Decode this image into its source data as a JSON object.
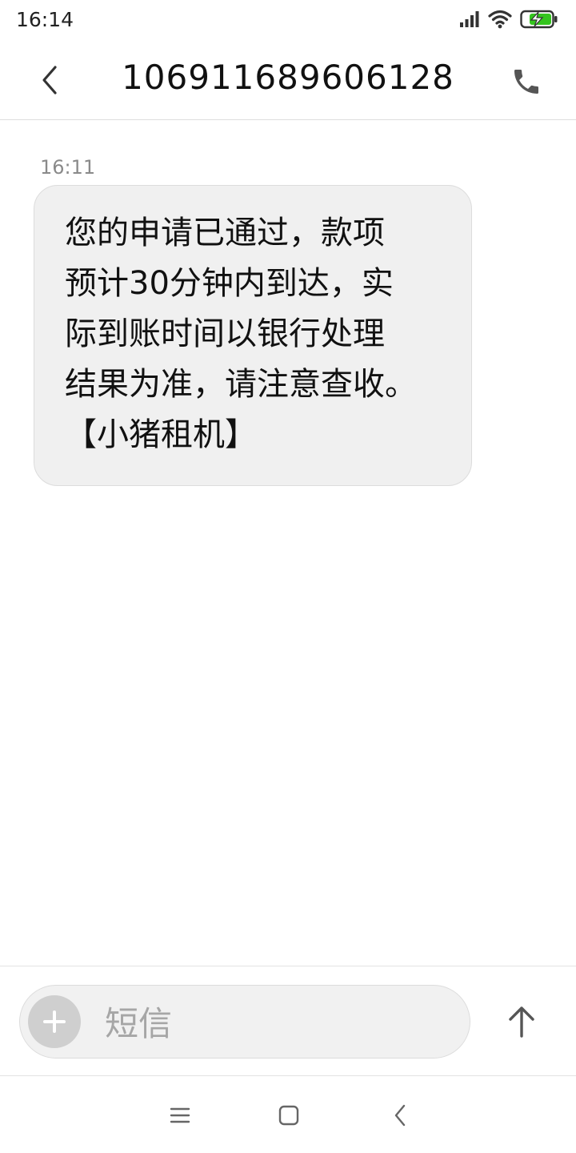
{
  "status_bar": {
    "time": "16:14",
    "icons": [
      "signal-icon",
      "wifi-icon",
      "battery-charging-icon"
    ],
    "battery_color": "#35c41f"
  },
  "header": {
    "title": "106911689606128",
    "back_icon": "chevron-left-icon",
    "call_icon": "phone-icon"
  },
  "messages": [
    {
      "time": "16:11",
      "text": "您的申请已通过，款项\n预计30分钟内到达，实\n际到账时间以银行处理\n结果为准，请注意查收。\n【小猪租机】"
    }
  ],
  "input": {
    "placeholder": "短信",
    "attach_icon": "plus-icon",
    "send_icon": "arrow-up-icon"
  },
  "nav_bar": {
    "buttons": [
      "menu-icon",
      "home-square-icon",
      "back-chevron-icon"
    ]
  }
}
